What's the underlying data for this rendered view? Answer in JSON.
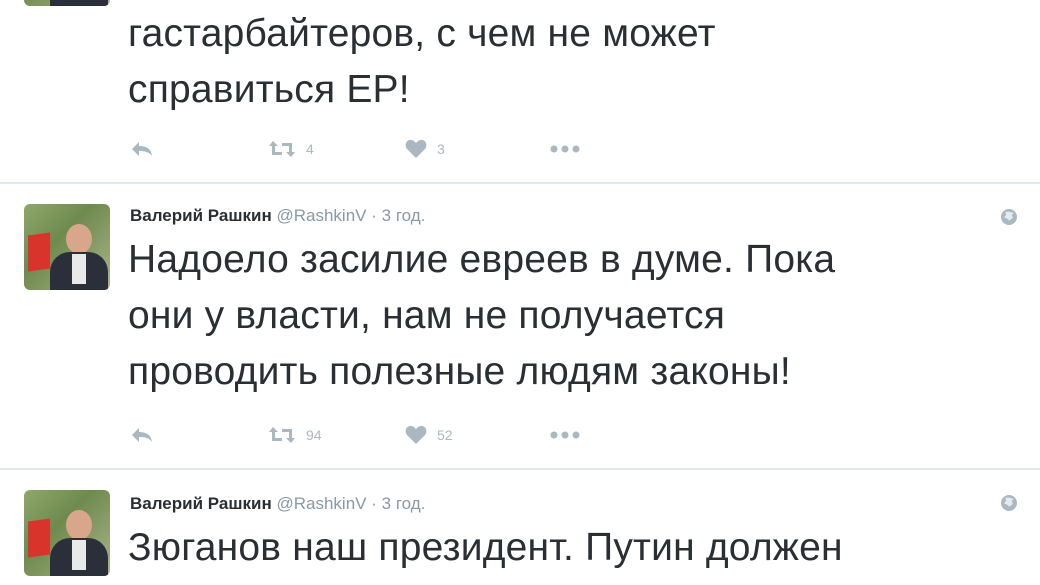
{
  "tweets": [
    {
      "text_lines": [
        "гастарбайтеров, с чем не может",
        "справиться ЕР!"
      ],
      "retweets": "4",
      "likes": "3"
    },
    {
      "name": "Валерий Рашкин",
      "handle": "@RashkinV",
      "dot": "·",
      "time": "3 год.",
      "text_lines": [
        "Надоело засилие евреев в думе. Пока",
        "они у власти, нам не получается",
        "проводить полезные людям законы!"
      ],
      "retweets": "94",
      "likes": "52"
    },
    {
      "name": "Валерий Рашкин",
      "handle": "@RashkinV",
      "dot": "·",
      "time": "3 год.",
      "text_lines": [
        "Зюганов наш президент. Путин должен"
      ]
    }
  ],
  "icons": {
    "reply": "reply-icon",
    "retweet": "retweet-icon",
    "like": "heart-icon",
    "more": "more-icon",
    "globe": "globe-icon"
  },
  "colors": {
    "text": "#292f33",
    "meta": "#8899a6",
    "action": "#aab8c2",
    "divider": "#e1e8ed"
  }
}
